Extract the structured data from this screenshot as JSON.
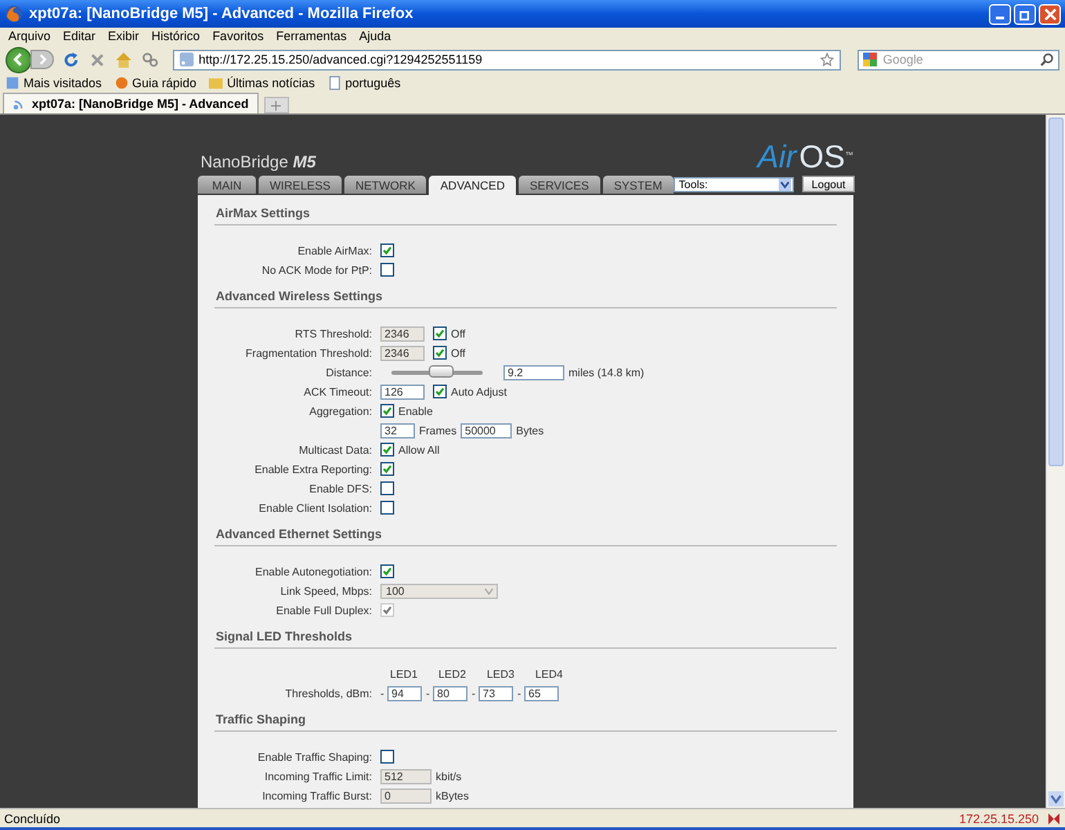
{
  "window": {
    "title": "xpt07a: [NanoBridge M5] - Advanced - Mozilla Firefox"
  },
  "menu": [
    "Arquivo",
    "Editar",
    "Exibir",
    "Histórico",
    "Favoritos",
    "Ferramentas",
    "Ajuda"
  ],
  "address_bar": {
    "value": "http://172.25.15.250/advanced.cgi?1294252551159"
  },
  "search": {
    "placeholder": "Google"
  },
  "bookmarks": [
    {
      "label": "Mais visitados",
      "kind": "star"
    },
    {
      "label": "Guia rápido",
      "kind": "firefox"
    },
    {
      "label": "Últimas notícias",
      "kind": "feed"
    },
    {
      "label": "português",
      "kind": "page"
    }
  ],
  "tabs": [
    {
      "label": "xpt07a: [NanoBridge M5] - Advanced",
      "selected": true
    }
  ],
  "device": {
    "brand": "NanoBridge",
    "model": "M5",
    "logo": "Air",
    "logo_suffix": "OS",
    "trademark": "™"
  },
  "nav_tabs": [
    {
      "label": "MAIN",
      "selected": false
    },
    {
      "label": "WIRELESS",
      "selected": false
    },
    {
      "label": "NETWORK",
      "selected": false
    },
    {
      "label": "ADVANCED",
      "selected": true
    },
    {
      "label": "SERVICES",
      "selected": false
    },
    {
      "label": "SYSTEM",
      "selected": false
    }
  ],
  "tools": {
    "value": "Tools:"
  },
  "logout": "Logout",
  "sections": [
    {
      "title": "AirMax Settings",
      "rows": [
        {
          "kind": "checkbox",
          "label": "Enable AirMax:",
          "checked": true,
          "disabled": false
        },
        {
          "kind": "checkbox",
          "label": "No ACK Mode for PtP:",
          "checked": false,
          "disabled": false
        }
      ]
    },
    {
      "title": "Advanced Wireless Settings",
      "rows": [
        {
          "kind": "input_check",
          "label": "RTS Threshold:",
          "value": "2346",
          "disabled": true,
          "checked": true,
          "option": "Off"
        },
        {
          "kind": "input_check",
          "label": "Fragmentation Threshold:",
          "value": "2346",
          "disabled": true,
          "checked": true,
          "option": "Off"
        },
        {
          "kind": "slider",
          "label": "Distance:",
          "level": 0.55,
          "value": "9.2",
          "unit": "miles (14.8 km)"
        },
        {
          "kind": "input_check",
          "label": "ACK Timeout:",
          "value": "126",
          "disabled": false,
          "checked": true,
          "option": "Auto Adjust"
        },
        {
          "kind": "check_option",
          "label": "Aggregation:",
          "checked": true,
          "option": "Enable"
        },
        {
          "kind": "inputs",
          "fields": [
            {
              "value": "32",
              "unit": "Frames"
            },
            {
              "value": "50000",
              "unit": "Bytes"
            }
          ]
        },
        {
          "kind": "check_option",
          "label": "Multicast Data:",
          "checked": true,
          "option": "Allow All"
        },
        {
          "kind": "checkbox",
          "label": "Enable Extra Reporting:",
          "checked": true,
          "disabled": false
        },
        {
          "kind": "checkbox",
          "label": "Enable DFS:",
          "checked": false,
          "disabled": false
        },
        {
          "kind": "checkbox",
          "label": "Enable Client Isolation:",
          "checked": false,
          "disabled": false
        }
      ]
    },
    {
      "title": "Advanced Ethernet Settings",
      "rows": [
        {
          "kind": "checkbox",
          "label": "Enable Autonegotiation:",
          "checked": true,
          "disabled": false
        },
        {
          "kind": "select",
          "label": "Link Speed, Mbps:",
          "value": "100",
          "disabled": true
        },
        {
          "kind": "checkbox",
          "label": "Enable Full Duplex:",
          "checked": true,
          "disabled": true
        }
      ]
    },
    {
      "title": "Signal LED Thresholds",
      "rows": [
        {
          "kind": "leds",
          "label": "Thresholds, dBm:",
          "leds": [
            {
              "name": "LED1",
              "sign": "-",
              "value": "94"
            },
            {
              "name": "LED2",
              "sign": "-",
              "value": "80"
            },
            {
              "name": "LED3",
              "sign": "-",
              "value": "73"
            },
            {
              "name": "LED4",
              "sign": "-",
              "value": "65"
            }
          ]
        }
      ]
    },
    {
      "title": "Traffic Shaping",
      "rows": [
        {
          "kind": "checkbox",
          "label": "Enable Traffic Shaping:",
          "checked": false,
          "disabled": false
        },
        {
          "kind": "input_unit",
          "label": "Incoming Traffic Limit:",
          "value": "512",
          "disabled": true,
          "unit": "kbit/s"
        },
        {
          "kind": "input_unit",
          "label": "Incoming Traffic Burst:",
          "value": "0",
          "disabled": true,
          "unit": "kBytes"
        }
      ]
    }
  ],
  "status_bar": {
    "text": "Concluído",
    "address": "172.25.15.250"
  }
}
